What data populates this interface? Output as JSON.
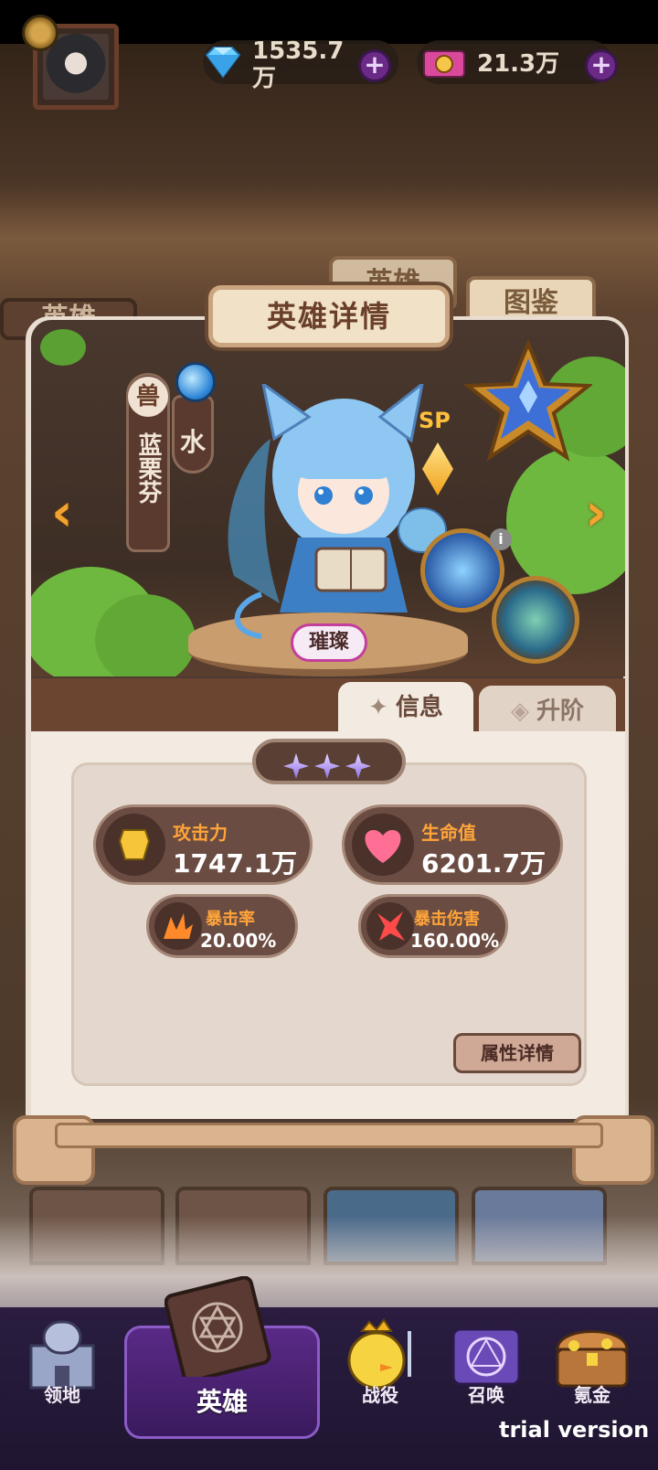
{
  "resources": {
    "diamonds": "1535.7\n万",
    "diamonds_line1": "1535.7",
    "diamonds_line2": "万",
    "tickets": "21.3万"
  },
  "top_tabs": {
    "left_partial": "英雄",
    "middle_partial": "英雄",
    "right": "图鉴"
  },
  "hero": {
    "panel_title": "英雄详情",
    "faction": "兽",
    "name": "蓝栗芬",
    "element": "水",
    "sp_label": "SP",
    "rarity": "璀璨",
    "star_count": 3
  },
  "tabs": {
    "info": "信息",
    "upgrade": "升阶"
  },
  "stats": {
    "attack_label": "攻击力",
    "attack_value": "1747.1万",
    "hp_label": "生命值",
    "hp_value": "6201.7万",
    "crit_rate_label": "暴击率",
    "crit_rate_value": "20.00%",
    "crit_dmg_label": "暴击伤害",
    "crit_dmg_value": "160.00%",
    "detail_button": "属性详情"
  },
  "nav": {
    "territory": "领地",
    "hero": "英雄",
    "campaign": "战役",
    "summon": "召唤",
    "shop": "氪金"
  },
  "watermark": "trial version",
  "colors": {
    "accent_orange": "#ffa43a",
    "panel_brown": "#6b4c42",
    "nav_purple": "#3a1a5e"
  }
}
